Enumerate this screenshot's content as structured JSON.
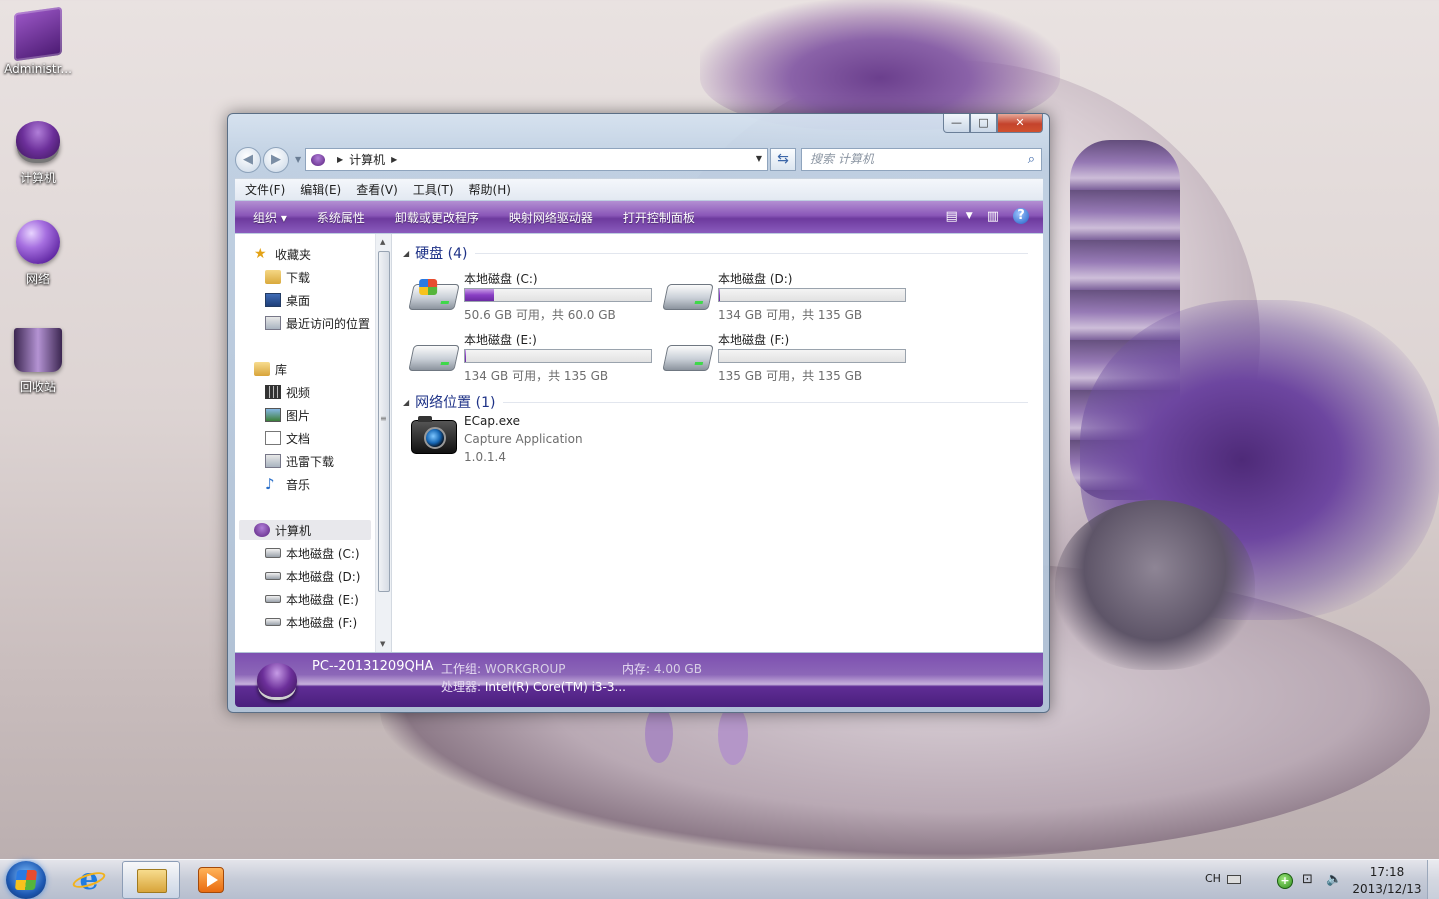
{
  "desktop": {
    "icons": [
      {
        "label": "Administr..."
      },
      {
        "label": "计算机"
      },
      {
        "label": "网络"
      },
      {
        "label": "回收站"
      }
    ]
  },
  "window": {
    "controls": {
      "minimize": "—",
      "maximize": "□",
      "close": "✕"
    },
    "address": {
      "location": "计算机",
      "separator_glyph": "▶",
      "dropdown_glyph": "▼",
      "refresh_glyph": "⇆"
    },
    "search": {
      "placeholder": "搜索 计算机",
      "icon": "search-icon"
    },
    "menu": [
      "文件(F)",
      "编辑(E)",
      "查看(V)",
      "工具(T)",
      "帮助(H)"
    ],
    "commands": [
      "组织 ▾",
      "系统属性",
      "卸载或更改程序",
      "映射网络驱动器",
      "打开控制面板"
    ],
    "accent_color": "#8a57b8",
    "nav": {
      "favorites": {
        "header": "收藏夹",
        "items": [
          "下载",
          "桌面",
          "最近访问的位置"
        ]
      },
      "libraries": {
        "header": "库",
        "items": [
          "视频",
          "图片",
          "文档",
          "迅雷下载",
          "音乐"
        ]
      },
      "computer": {
        "header": "计算机",
        "items": [
          "本地磁盘 (C:)",
          "本地磁盘 (D:)",
          "本地磁盘 (E:)",
          "本地磁盘 (F:)"
        ]
      }
    },
    "groups": {
      "drives": {
        "header": "硬盘 (4)",
        "items": [
          {
            "name": "本地磁盘 (C:)",
            "info": "50.6 GB 可用，共 60.0 GB",
            "used_fraction": 0.157,
            "windows": true
          },
          {
            "name": "本地磁盘 (D:)",
            "info": "134 GB 可用，共 135 GB",
            "used_fraction": 0.007,
            "windows": false
          },
          {
            "name": "本地磁盘 (E:)",
            "info": "134 GB 可用，共 135 GB",
            "used_fraction": 0.007,
            "windows": false
          },
          {
            "name": "本地磁盘 (F:)",
            "info": "135 GB 可用，共 135 GB",
            "used_fraction": 0.0,
            "windows": false
          }
        ]
      },
      "network": {
        "header": "网络位置 (1)",
        "item": {
          "name": "ECap.exe",
          "description": "Capture Application",
          "version": "1.0.1.4"
        }
      }
    },
    "details": {
      "computer_name": "PC--20131209QHA",
      "workgroup_label": "工作组:",
      "workgroup": "WORKGROUP",
      "memory_label": "内存:",
      "memory": "4.00 GB",
      "processor_label": "处理器:",
      "processor": "Intel(R) Core(TM) i3-3..."
    }
  },
  "taskbar": {
    "language": "CH",
    "time": "17:18",
    "date": "2013/12/13"
  }
}
